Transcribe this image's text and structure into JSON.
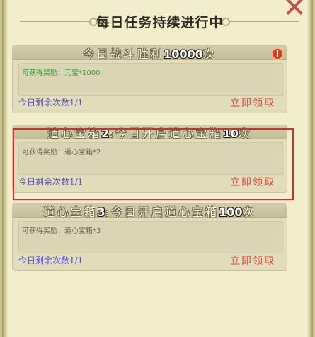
{
  "header": {
    "title": "每日任务持续进行中"
  },
  "tasks": [
    {
      "title_prefix": "今日战斗胜利",
      "title_number": "10000",
      "title_suffix": "次",
      "reward_label": "可获得奖励：元宝*1000",
      "reward_color": "#3e9a3a",
      "remaining": "今日剩余次数1/1",
      "claim_label": "立即领取",
      "has_alert": true,
      "alert_glyph": "!"
    },
    {
      "title_prefix": "道心宝箱",
      "title_number": "2",
      "title_mid": ":今日开启道心宝箱",
      "title_number2": "10",
      "title_suffix": "次",
      "reward_label": "可获得奖励：道心宝箱*2",
      "reward_color": "#6b6656",
      "remaining": "今日剩余次数1/1",
      "claim_label": "立即领取",
      "has_alert": false
    },
    {
      "title_prefix": "道心宝箱",
      "title_number": "3",
      "title_mid": ":今日开启道心宝箱",
      "title_number2": "100",
      "title_suffix": "次",
      "reward_label": "可获得奖励：道心宝箱*3",
      "reward_color": "#6b6656",
      "remaining": "今日剩余次数1/1",
      "claim_label": "立即领取",
      "has_alert": false
    }
  ],
  "close_glyph": "✕",
  "accent": {
    "highlight_border": "#e8232a",
    "claim_color": "#d04a3a",
    "remaining_color": "#5a52c8"
  }
}
